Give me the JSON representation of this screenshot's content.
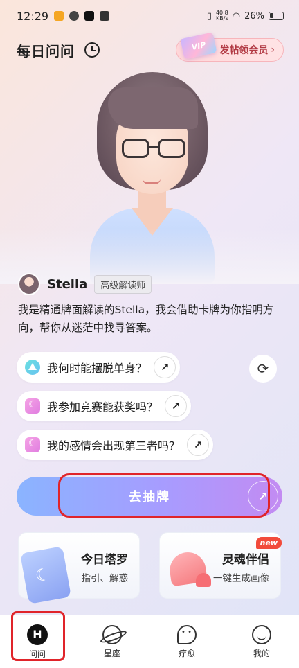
{
  "status_bar": {
    "time": "12:29",
    "net_speed_value": "40.8",
    "net_speed_unit": "KB/s",
    "battery": "26%"
  },
  "header": {
    "title": "每日问问",
    "vip_card_text": "VIP",
    "vip_promo": "发帖领会员"
  },
  "reader": {
    "name": "Stella",
    "badge": "高级解读师",
    "intro": "我是精通牌面解读的Stella，我会借助卡牌为你指明方向，帮你从迷茫中找寻答案。"
  },
  "questions": [
    {
      "text": "我何时能摆脱单身？",
      "icon": "triangle-icon"
    },
    {
      "text": "我参加竞赛能获奖吗？",
      "icon": "moon-icon"
    },
    {
      "text": "我的感情会出现第三者吗？",
      "icon": "moon-icon"
    }
  ],
  "draw_button": {
    "label": "去抽牌"
  },
  "cards": {
    "tarot": {
      "title": "今日塔罗",
      "subtitle": "指引、解惑"
    },
    "soul": {
      "title": "灵魂伴侣",
      "subtitle": "一键生成画像",
      "badge": "new"
    }
  },
  "tabbar": {
    "items": [
      {
        "label": "问问",
        "active": true
      },
      {
        "label": "星座",
        "active": false
      },
      {
        "label": "疗愈",
        "active": false
      },
      {
        "label": "我的",
        "active": false
      }
    ]
  },
  "colors": {
    "highlight": "#e0242a",
    "draw_gradient_start": "#8ab4ff",
    "draw_gradient_end": "#c38bf2",
    "vip_text": "#b23a44"
  }
}
